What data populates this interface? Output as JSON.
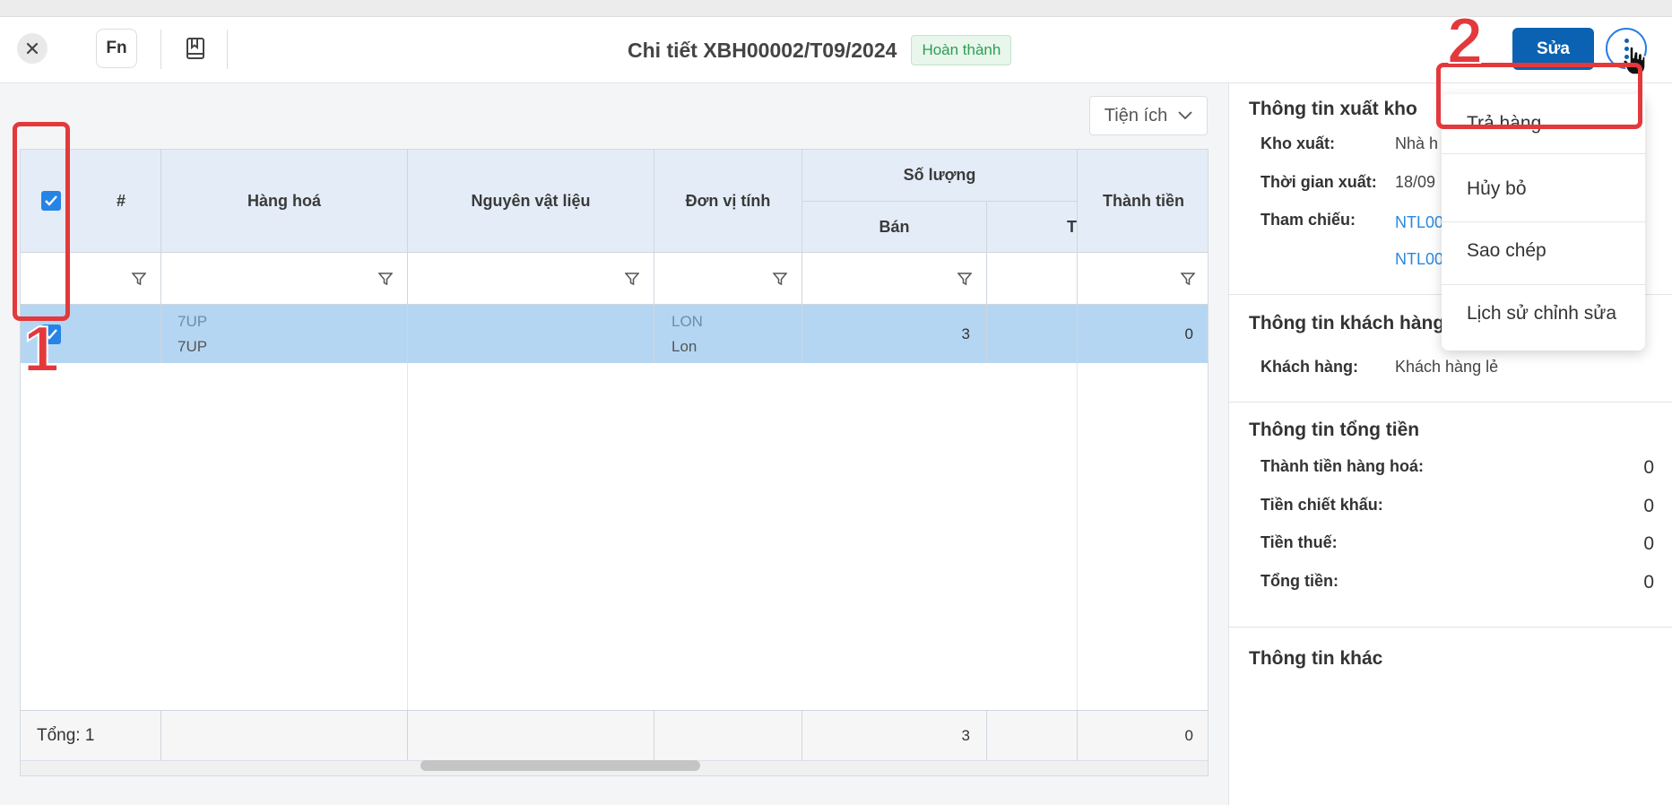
{
  "header": {
    "close_icon": "close-icon",
    "fn_label": "Fn",
    "book_icon": "bookmark-book-icon",
    "title": "Chi tiết XBH00002/T09/2024",
    "status": "Hoàn thành",
    "edit_label": "Sửa",
    "more_icon": "more-vertical-icon"
  },
  "toolbar": {
    "utils_label": "Tiện ích"
  },
  "table": {
    "headers": {
      "index": "#",
      "product": "Hàng hoá",
      "material": "Nguyên vật liệu",
      "unit": "Đơn vị tính",
      "quantity_group": "Số lượng",
      "sell": "Bán",
      "return_partial": "T",
      "amount": "Thành tiền"
    },
    "rows": [
      {
        "product_code": "7UP",
        "product_name": "7UP",
        "unit_code": "LON",
        "unit_name": "Lon",
        "sell": "3",
        "amount": "0",
        "selected": true
      }
    ],
    "footer": {
      "total_label": "Tổng: 1",
      "sell_total": "3",
      "amount_total": "0"
    }
  },
  "side": {
    "export_title": "Thông tin xuất kho",
    "warehouse_label": "Kho xuất:",
    "warehouse_value": "Nhà h",
    "time_label": "Thời gian xuất:",
    "time_value": "18/09",
    "ref_label": "Tham chiếu:",
    "ref_1": "NTL00",
    "ref_2": "NTL00",
    "customer_title": "Thông tin khách hàng",
    "customer_label": "Khách hàng:",
    "customer_value": "Khách hàng lẻ",
    "money_title": "Thông tin tổng tiền",
    "goods_amount_label": "Thành tiền hàng hoá:",
    "goods_amount_value": "0",
    "discount_label": "Tiền chiết khấu:",
    "discount_value": "0",
    "tax_label": "Tiền thuế:",
    "tax_value": "0",
    "total_label": "Tổng tiền:",
    "total_value": "0",
    "other_title": "Thông tin khác"
  },
  "menu": {
    "items": [
      "Trả hàng",
      "Hủy bỏ",
      "Sao chép",
      "Lịch sử chỉnh sửa"
    ]
  },
  "annotations": {
    "step1": "1",
    "step2": "2",
    "color": "#e3393c"
  }
}
